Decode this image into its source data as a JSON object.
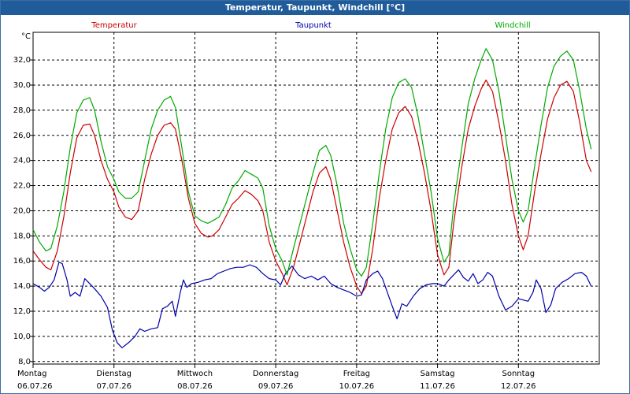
{
  "window": {
    "title": "Temperatur, Taupunkt, Windchill [°C]"
  },
  "chart_data": {
    "type": "line",
    "title": "Temperatur, Taupunkt, Windchill [°C]",
    "ylabel": "°C",
    "ylim": [
      7.8,
      34.2
    ],
    "yticks": [
      8,
      10,
      12,
      14,
      16,
      18,
      20,
      22,
      24,
      26,
      28,
      30,
      32
    ],
    "ytick_labels": [
      "8,0",
      "10,0",
      "12,0",
      "14,0",
      "16,0",
      "18,0",
      "20,0",
      "22,0",
      "24,0",
      "26,0",
      "28,0",
      "30,0",
      "32,0"
    ],
    "xlim": [
      0,
      7
    ],
    "grid": true,
    "x_categories": [
      {
        "day": "Montag",
        "date": "06.07.26"
      },
      {
        "day": "Dienstag",
        "date": "07.07.26"
      },
      {
        "day": "Mittwoch",
        "date": "08.07.26"
      },
      {
        "day": "Donnerstag",
        "date": "09.07.26"
      },
      {
        "day": "Freitag",
        "date": "10.07.26"
      },
      {
        "day": "Samstag",
        "date": "11.07.26"
      },
      {
        "day": "Sonntag",
        "date": "12.07.26"
      }
    ],
    "series": [
      {
        "name": "Temperatur",
        "color": "#cc0000",
        "points": [
          [
            0,
            16.8
          ],
          [
            0.08,
            16.1
          ],
          [
            0.16,
            15.5
          ],
          [
            0.22,
            15.3
          ],
          [
            0.3,
            16.8
          ],
          [
            0.38,
            19.5
          ],
          [
            0.46,
            23.0
          ],
          [
            0.54,
            25.8
          ],
          [
            0.62,
            26.8
          ],
          [
            0.7,
            26.9
          ],
          [
            0.76,
            26.0
          ],
          [
            0.84,
            24.0
          ],
          [
            0.92,
            22.5
          ],
          [
            1.0,
            21.5
          ],
          [
            1.06,
            20.3
          ],
          [
            1.14,
            19.5
          ],
          [
            1.22,
            19.3
          ],
          [
            1.3,
            20.0
          ],
          [
            1.38,
            22.5
          ],
          [
            1.46,
            24.5
          ],
          [
            1.54,
            26.0
          ],
          [
            1.62,
            26.8
          ],
          [
            1.7,
            27.0
          ],
          [
            1.76,
            26.5
          ],
          [
            1.84,
            24.0
          ],
          [
            1.92,
            21.0
          ],
          [
            2.0,
            19.0
          ],
          [
            2.08,
            18.2
          ],
          [
            2.16,
            17.9
          ],
          [
            2.22,
            18.0
          ],
          [
            2.3,
            18.5
          ],
          [
            2.38,
            19.5
          ],
          [
            2.46,
            20.5
          ],
          [
            2.54,
            21.0
          ],
          [
            2.62,
            21.6
          ],
          [
            2.7,
            21.3
          ],
          [
            2.78,
            20.8
          ],
          [
            2.84,
            20.0
          ],
          [
            2.92,
            17.5
          ],
          [
            3.0,
            16.0
          ],
          [
            3.08,
            15.0
          ],
          [
            3.14,
            14.1
          ],
          [
            3.22,
            15.5
          ],
          [
            3.3,
            17.5
          ],
          [
            3.38,
            19.5
          ],
          [
            3.46,
            21.5
          ],
          [
            3.54,
            23.0
          ],
          [
            3.62,
            23.5
          ],
          [
            3.68,
            22.5
          ],
          [
            3.76,
            20.0
          ],
          [
            3.84,
            17.5
          ],
          [
            3.92,
            15.5
          ],
          [
            4.0,
            14.0
          ],
          [
            4.06,
            13.4
          ],
          [
            4.12,
            14.0
          ],
          [
            4.2,
            17.0
          ],
          [
            4.28,
            21.0
          ],
          [
            4.36,
            24.0
          ],
          [
            4.44,
            26.5
          ],
          [
            4.52,
            27.8
          ],
          [
            4.6,
            28.3
          ],
          [
            4.68,
            27.5
          ],
          [
            4.76,
            25.5
          ],
          [
            4.84,
            23.0
          ],
          [
            4.92,
            20.0
          ],
          [
            5.0,
            16.5
          ],
          [
            5.08,
            14.9
          ],
          [
            5.14,
            15.5
          ],
          [
            5.2,
            19.0
          ],
          [
            5.3,
            23.5
          ],
          [
            5.38,
            26.5
          ],
          [
            5.46,
            28.3
          ],
          [
            5.54,
            29.7
          ],
          [
            5.6,
            30.4
          ],
          [
            5.68,
            29.5
          ],
          [
            5.76,
            27.0
          ],
          [
            5.84,
            24.0
          ],
          [
            5.92,
            20.5
          ],
          [
            6.0,
            18.0
          ],
          [
            6.06,
            16.9
          ],
          [
            6.12,
            18.0
          ],
          [
            6.2,
            21.5
          ],
          [
            6.28,
            24.5
          ],
          [
            6.36,
            27.3
          ],
          [
            6.44,
            29.0
          ],
          [
            6.52,
            30.0
          ],
          [
            6.6,
            30.3
          ],
          [
            6.68,
            29.5
          ],
          [
            6.76,
            27.0
          ],
          [
            6.84,
            24.0
          ],
          [
            6.9,
            23.1
          ]
        ]
      },
      {
        "name": "Taupunkt",
        "color": "#0000aa",
        "points": [
          [
            0,
            14.2
          ],
          [
            0.08,
            13.9
          ],
          [
            0.14,
            13.6
          ],
          [
            0.2,
            13.9
          ],
          [
            0.26,
            14.5
          ],
          [
            0.32,
            15.9
          ],
          [
            0.36,
            15.8
          ],
          [
            0.42,
            14.5
          ],
          [
            0.46,
            13.2
          ],
          [
            0.52,
            13.5
          ],
          [
            0.58,
            13.2
          ],
          [
            0.64,
            14.6
          ],
          [
            0.7,
            14.2
          ],
          [
            0.76,
            13.8
          ],
          [
            0.84,
            13.2
          ],
          [
            0.92,
            12.3
          ],
          [
            0.98,
            10.5
          ],
          [
            1.04,
            9.5
          ],
          [
            1.1,
            9.1
          ],
          [
            1.18,
            9.5
          ],
          [
            1.26,
            10.0
          ],
          [
            1.32,
            10.6
          ],
          [
            1.38,
            10.4
          ],
          [
            1.46,
            10.6
          ],
          [
            1.54,
            10.7
          ],
          [
            1.6,
            12.2
          ],
          [
            1.66,
            12.4
          ],
          [
            1.72,
            12.8
          ],
          [
            1.76,
            11.6
          ],
          [
            1.82,
            13.5
          ],
          [
            1.86,
            14.5
          ],
          [
            1.9,
            13.9
          ],
          [
            1.96,
            14.2
          ],
          [
            2.04,
            14.3
          ],
          [
            2.12,
            14.5
          ],
          [
            2.2,
            14.6
          ],
          [
            2.28,
            15.0
          ],
          [
            2.36,
            15.2
          ],
          [
            2.44,
            15.4
          ],
          [
            2.52,
            15.5
          ],
          [
            2.6,
            15.5
          ],
          [
            2.68,
            15.7
          ],
          [
            2.76,
            15.5
          ],
          [
            2.84,
            15.0
          ],
          [
            2.92,
            14.6
          ],
          [
            3.0,
            14.5
          ],
          [
            3.06,
            14.1
          ],
          [
            3.12,
            15.0
          ],
          [
            3.2,
            15.6
          ],
          [
            3.28,
            14.9
          ],
          [
            3.36,
            14.6
          ],
          [
            3.44,
            14.8
          ],
          [
            3.52,
            14.5
          ],
          [
            3.6,
            14.8
          ],
          [
            3.68,
            14.2
          ],
          [
            3.76,
            13.9
          ],
          [
            3.84,
            13.7
          ],
          [
            3.92,
            13.5
          ],
          [
            4.0,
            13.2
          ],
          [
            4.06,
            13.3
          ],
          [
            4.12,
            14.5
          ],
          [
            4.2,
            15.0
          ],
          [
            4.26,
            15.2
          ],
          [
            4.32,
            14.6
          ],
          [
            4.38,
            13.5
          ],
          [
            4.44,
            12.4
          ],
          [
            4.5,
            11.4
          ],
          [
            4.56,
            12.6
          ],
          [
            4.62,
            12.4
          ],
          [
            4.7,
            13.2
          ],
          [
            4.78,
            13.8
          ],
          [
            4.86,
            14.1
          ],
          [
            4.94,
            14.2
          ],
          [
            5.0,
            14.2
          ],
          [
            5.08,
            14.0
          ],
          [
            5.14,
            14.5
          ],
          [
            5.2,
            14.9
          ],
          [
            5.26,
            15.3
          ],
          [
            5.32,
            14.7
          ],
          [
            5.38,
            14.4
          ],
          [
            5.44,
            15.0
          ],
          [
            5.5,
            14.2
          ],
          [
            5.56,
            14.5
          ],
          [
            5.62,
            15.1
          ],
          [
            5.68,
            14.8
          ],
          [
            5.76,
            13.2
          ],
          [
            5.84,
            12.1
          ],
          [
            5.92,
            12.4
          ],
          [
            6.0,
            13.0
          ],
          [
            6.06,
            12.9
          ],
          [
            6.12,
            12.8
          ],
          [
            6.18,
            13.5
          ],
          [
            6.22,
            14.5
          ],
          [
            6.28,
            13.8
          ],
          [
            6.34,
            11.9
          ],
          [
            6.4,
            12.5
          ],
          [
            6.46,
            13.8
          ],
          [
            6.54,
            14.3
          ],
          [
            6.62,
            14.6
          ],
          [
            6.7,
            15.0
          ],
          [
            6.78,
            15.1
          ],
          [
            6.84,
            14.8
          ],
          [
            6.9,
            14.0
          ]
        ]
      },
      {
        "name": "Windchill",
        "color": "#00aa00",
        "points": [
          [
            0,
            18.5
          ],
          [
            0.08,
            17.5
          ],
          [
            0.16,
            16.8
          ],
          [
            0.22,
            17.0
          ],
          [
            0.3,
            18.8
          ],
          [
            0.38,
            21.5
          ],
          [
            0.46,
            25.0
          ],
          [
            0.54,
            27.8
          ],
          [
            0.62,
            28.8
          ],
          [
            0.7,
            29.0
          ],
          [
            0.76,
            28.0
          ],
          [
            0.84,
            25.5
          ],
          [
            0.92,
            23.5
          ],
          [
            1.0,
            22.5
          ],
          [
            1.06,
            21.5
          ],
          [
            1.14,
            21.0
          ],
          [
            1.22,
            21.0
          ],
          [
            1.3,
            21.5
          ],
          [
            1.38,
            24.0
          ],
          [
            1.46,
            26.5
          ],
          [
            1.54,
            28.0
          ],
          [
            1.62,
            28.8
          ],
          [
            1.7,
            29.1
          ],
          [
            1.76,
            28.2
          ],
          [
            1.84,
            25.0
          ],
          [
            1.92,
            21.5
          ],
          [
            2.0,
            19.6
          ],
          [
            2.08,
            19.2
          ],
          [
            2.16,
            19.0
          ],
          [
            2.22,
            19.2
          ],
          [
            2.3,
            19.5
          ],
          [
            2.38,
            20.5
          ],
          [
            2.46,
            21.8
          ],
          [
            2.54,
            22.4
          ],
          [
            2.62,
            23.2
          ],
          [
            2.7,
            22.9
          ],
          [
            2.78,
            22.6
          ],
          [
            2.84,
            21.8
          ],
          [
            2.92,
            18.8
          ],
          [
            3.0,
            17.0
          ],
          [
            3.08,
            16.0
          ],
          [
            3.14,
            14.9
          ],
          [
            3.22,
            17.0
          ],
          [
            3.3,
            19.0
          ],
          [
            3.38,
            21.0
          ],
          [
            3.46,
            23.0
          ],
          [
            3.54,
            24.8
          ],
          [
            3.62,
            25.2
          ],
          [
            3.68,
            24.4
          ],
          [
            3.76,
            22.0
          ],
          [
            3.84,
            19.0
          ],
          [
            3.92,
            17.0
          ],
          [
            4.0,
            15.3
          ],
          [
            4.06,
            14.8
          ],
          [
            4.12,
            15.5
          ],
          [
            4.2,
            19.0
          ],
          [
            4.28,
            23.0
          ],
          [
            4.36,
            26.5
          ],
          [
            4.44,
            29.0
          ],
          [
            4.52,
            30.2
          ],
          [
            4.6,
            30.5
          ],
          [
            4.68,
            29.8
          ],
          [
            4.76,
            27.5
          ],
          [
            4.84,
            24.5
          ],
          [
            4.92,
            21.5
          ],
          [
            5.0,
            17.8
          ],
          [
            5.08,
            15.9
          ],
          [
            5.14,
            16.5
          ],
          [
            5.2,
            20.5
          ],
          [
            5.3,
            25.0
          ],
          [
            5.38,
            28.5
          ],
          [
            5.46,
            30.5
          ],
          [
            5.54,
            32.0
          ],
          [
            5.6,
            32.9
          ],
          [
            5.68,
            32.0
          ],
          [
            5.76,
            29.5
          ],
          [
            5.84,
            26.0
          ],
          [
            5.92,
            22.5
          ],
          [
            6.0,
            20.0
          ],
          [
            6.06,
            19.1
          ],
          [
            6.12,
            20.0
          ],
          [
            6.2,
            23.5
          ],
          [
            6.28,
            26.8
          ],
          [
            6.36,
            29.8
          ],
          [
            6.44,
            31.5
          ],
          [
            6.52,
            32.3
          ],
          [
            6.6,
            32.7
          ],
          [
            6.68,
            32.0
          ],
          [
            6.76,
            29.5
          ],
          [
            6.84,
            26.5
          ],
          [
            6.9,
            24.9
          ]
        ]
      }
    ]
  }
}
